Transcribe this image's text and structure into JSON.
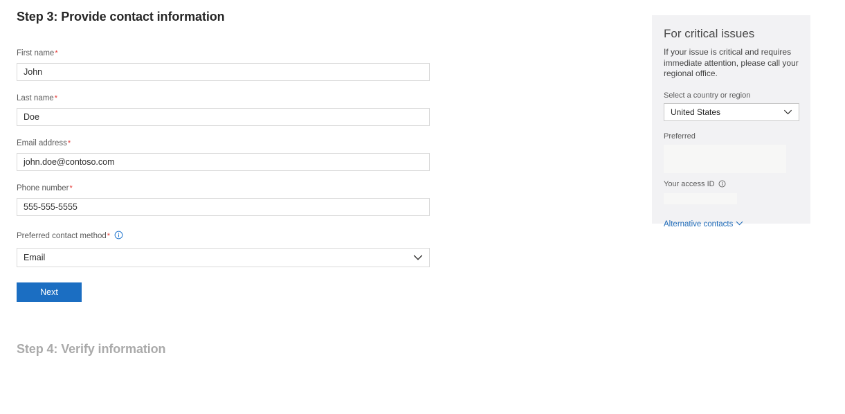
{
  "form": {
    "title": "Step 3: Provide contact information",
    "fields": [
      {
        "label": "First name",
        "required_marker": "*",
        "value": "John",
        "placeholder": "First name",
        "type": "text"
      },
      {
        "label": "Last name",
        "required_marker": "*",
        "value": "Doe",
        "placeholder": "Last name",
        "type": "text"
      },
      {
        "label": "Email address",
        "required_marker": "*",
        "value": "john.doe@contoso.com",
        "placeholder": "Email address",
        "type": "email"
      },
      {
        "label": "Phone number",
        "required_marker": "*",
        "value": "555-555-5555",
        "placeholder": "Phone number",
        "type": "tel"
      },
      {
        "label": "Preferred contact method",
        "required_marker": "*",
        "value": "Email",
        "type": "select",
        "info_icon": "info-circle-icon"
      }
    ],
    "submit_label": "Next",
    "next_step_title": "Step 4: Verify information"
  },
  "panel": {
    "title": "For critical issues",
    "description": "If your issue is critical and requires immediate attention, please call your regional office.",
    "country_label": "Select a country or region",
    "country_value": "United States",
    "preferred_label": "Preferred",
    "access_id_label": "Your access ID",
    "access_id_info_icon": "info-circle-icon",
    "alternative_contacts_label": "Alternative contacts",
    "alternative_contacts_icon": "chevron-down-icon"
  },
  "colors": {
    "accent_blue": "#1b6ec2",
    "link_blue": "#1f6bb8",
    "required_red": "#e53935",
    "panel_background": "#f2f2f4",
    "skeleton": "#f7f7f6",
    "disabled_text": "#aaaaaa"
  },
  "icons": {
    "info": "info-circle-icon",
    "chevron_down": "chevron-down-icon"
  }
}
